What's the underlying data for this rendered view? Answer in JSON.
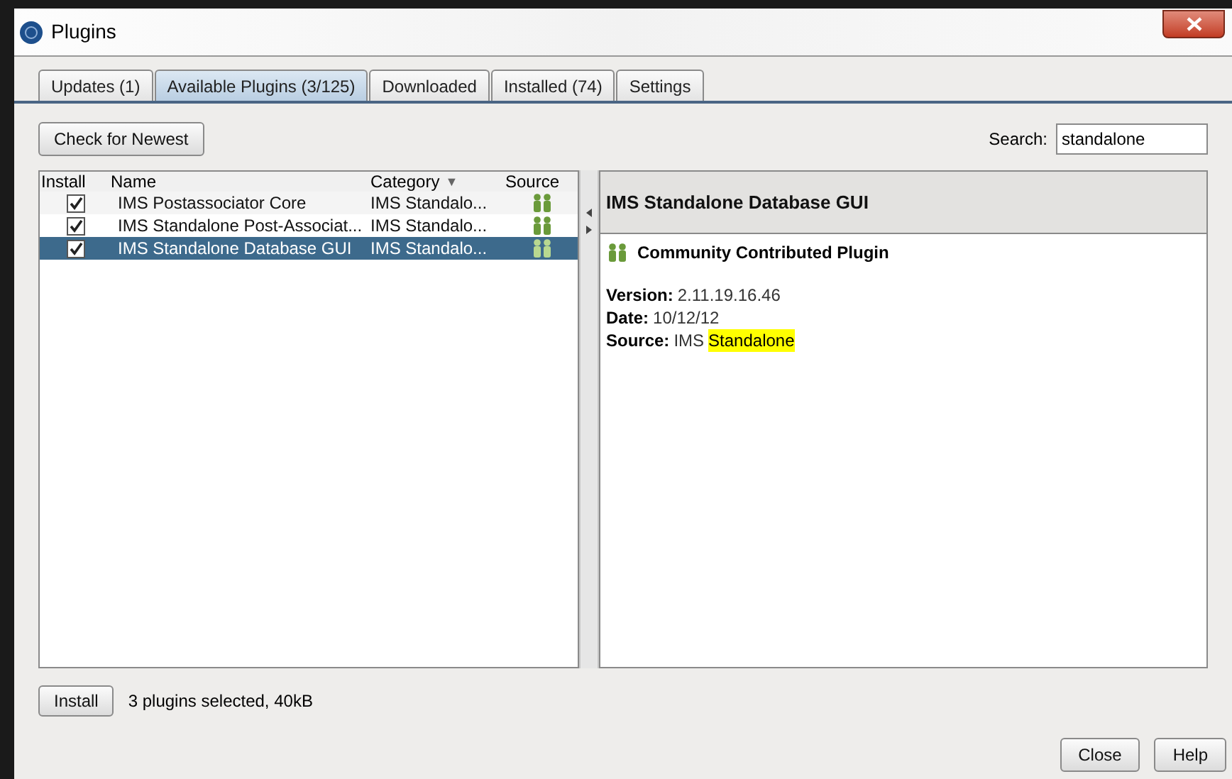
{
  "window": {
    "title": "Plugins"
  },
  "tabs": [
    {
      "label": "Updates (1)",
      "selected": false
    },
    {
      "label": "Available Plugins (3/125)",
      "selected": true
    },
    {
      "label": "Downloaded",
      "selected": false
    },
    {
      "label": "Installed (74)",
      "selected": false
    },
    {
      "label": "Settings",
      "selected": false
    }
  ],
  "check_button": "Check for Newest",
  "search": {
    "label": "Search:",
    "value": "standalone"
  },
  "table": {
    "columns": [
      "Install",
      "Name",
      "Category",
      "Source"
    ],
    "sort_marker": "▼",
    "rows": [
      {
        "install": true,
        "name": "IMS Postassociator Core",
        "category": "IMS Standalo...",
        "selected": false
      },
      {
        "install": true,
        "name": "IMS Standalone Post-Associat...",
        "category": "IMS Standalo...",
        "selected": false
      },
      {
        "install": true,
        "name": "IMS Standalone Database GUI",
        "category": "IMS Standalo...",
        "selected": true
      }
    ]
  },
  "details": {
    "title": "IMS Standalone Database GUI",
    "source_type": "Community Contributed Plugin",
    "fields": [
      {
        "label": "Version:",
        "value": "2.11.19.16.46"
      },
      {
        "label": "Date:",
        "value": "10/12/12"
      },
      {
        "label": "Source:",
        "value": "IMS",
        "highlight": "Standalone"
      }
    ]
  },
  "install_button": "Install",
  "status": "3 plugins selected, 40kB",
  "buttons": [
    "Close",
    "Help"
  ]
}
